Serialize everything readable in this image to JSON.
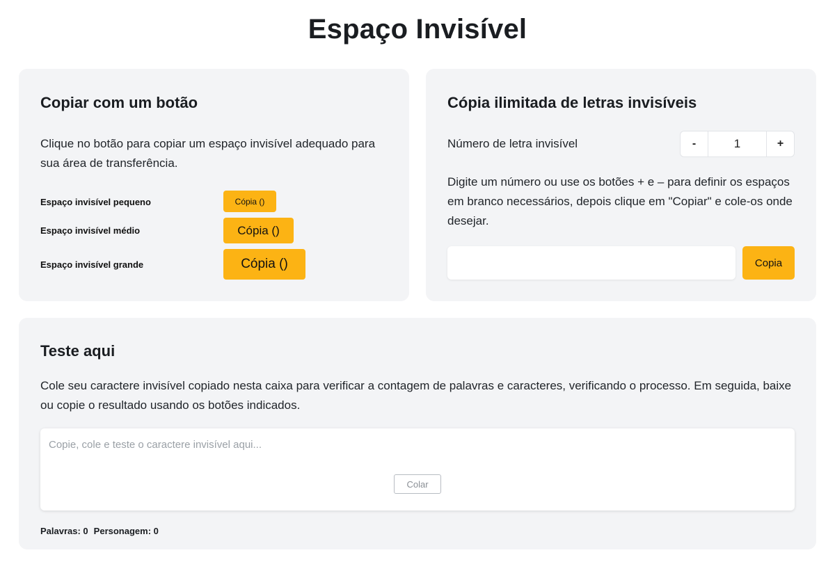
{
  "page": {
    "title": "Espaço Invisível"
  },
  "copy_one": {
    "heading": "Copiar com um botão",
    "description": "Clique no botão para copiar um espaço invisível adequado para sua área de transferência.",
    "items": [
      {
        "label": "Espaço invisível pequeno",
        "button": "Cópia ()"
      },
      {
        "label": "Espaço invisível médio",
        "button": "Cópia ()"
      },
      {
        "label": "Espaço invisível grande",
        "button": "Cópia ()"
      }
    ]
  },
  "unlimited": {
    "heading": "Cópia ilimitada de letras invisíveis",
    "count_label": "Número de letra invisível",
    "minus_label": "-",
    "plus_label": "+",
    "count_value": "1",
    "description": "Digite um número ou use os botões + e – para definir os espaços em branco necessários, depois clique em \"Copiar\" e cole-os onde desejar.",
    "output_value": "",
    "copy_button": "Copia"
  },
  "test": {
    "heading": "Teste aqui",
    "description": "Cole seu caractere invisível copiado nesta caixa para verificar a contagem de palavras e caracteres, verificando o processo. Em seguida, baixe ou copie o resultado usando os botões indicados.",
    "placeholder": "Copie, cole e teste o caractere invisível aqui...",
    "paste_button": "Colar",
    "words_label": "Palavras: 0",
    "chars_label": "Personagem: 0"
  },
  "colors": {
    "accent": "#fcb314",
    "card_bg": "#f3f4f6"
  }
}
